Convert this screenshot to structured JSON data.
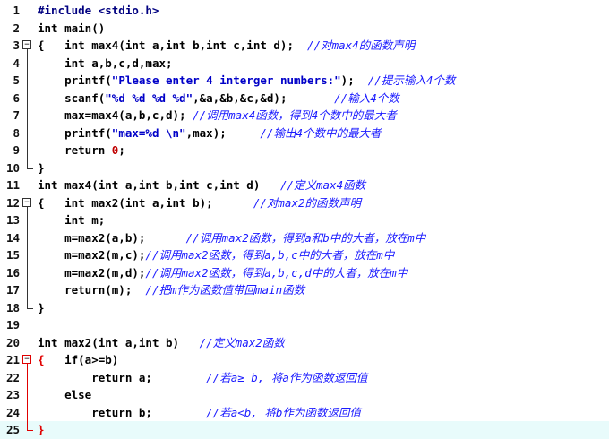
{
  "editor": {
    "current_line": 25,
    "lines": [
      {
        "n": "1",
        "fold": "",
        "segs": [
          [
            "pp",
            "#include <stdio.h>"
          ]
        ]
      },
      {
        "n": "2",
        "fold": "",
        "segs": [
          [
            "kw",
            "int "
          ],
          [
            "txt",
            "main()"
          ]
        ]
      },
      {
        "n": "3",
        "fold": "box",
        "segs": [
          [
            "txt",
            "{   "
          ],
          [
            "kw",
            "int "
          ],
          [
            "txt",
            "max4(int a,int b,int c,int d);  "
          ],
          [
            "cmt",
            "//对max4的函数声明"
          ]
        ]
      },
      {
        "n": "4",
        "fold": "",
        "segs": [
          [
            "txt",
            "    "
          ],
          [
            "kw",
            "int "
          ],
          [
            "txt",
            "a,b,c,d,max;"
          ]
        ]
      },
      {
        "n": "5",
        "fold": "",
        "segs": [
          [
            "txt",
            "    printf("
          ],
          [
            "str",
            "\"Please enter 4 interger numbers:\""
          ],
          [
            "txt",
            ");  "
          ],
          [
            "cmt",
            "//提示输入4个数"
          ]
        ]
      },
      {
        "n": "6",
        "fold": "",
        "segs": [
          [
            "txt",
            "    scanf("
          ],
          [
            "str",
            "\"%d %d %d %d\""
          ],
          [
            "txt",
            ",&a,&b,&c,&d);       "
          ],
          [
            "cmt",
            "//输入4个数"
          ]
        ]
      },
      {
        "n": "7",
        "fold": "",
        "segs": [
          [
            "txt",
            "    max=max4(a,b,c,d); "
          ],
          [
            "cmt",
            "//调用max4函数，得到4个数中的最大者"
          ]
        ]
      },
      {
        "n": "8",
        "fold": "",
        "segs": [
          [
            "txt",
            "    printf("
          ],
          [
            "str",
            "\"max=%d \\n\""
          ],
          [
            "txt",
            ",max);     "
          ],
          [
            "cmt",
            "//输出4个数中的最大者"
          ]
        ]
      },
      {
        "n": "9",
        "fold": "",
        "segs": [
          [
            "txt",
            "    return "
          ],
          [
            "num",
            "0"
          ],
          [
            "txt",
            ";"
          ]
        ]
      },
      {
        "n": "10",
        "fold": "end",
        "segs": [
          [
            "txt",
            "}"
          ]
        ]
      },
      {
        "n": "11",
        "fold": "",
        "segs": [
          [
            "kw",
            "int "
          ],
          [
            "txt",
            "max4(int a,int b,int c,int d)   "
          ],
          [
            "cmt",
            "//定义max4函数"
          ]
        ]
      },
      {
        "n": "12",
        "fold": "box",
        "segs": [
          [
            "txt",
            "{   "
          ],
          [
            "kw",
            "int "
          ],
          [
            "txt",
            "max2(int a,int b);      "
          ],
          [
            "cmt",
            "//对max2的函数声明"
          ]
        ]
      },
      {
        "n": "13",
        "fold": "",
        "segs": [
          [
            "txt",
            "    "
          ],
          [
            "kw",
            "int "
          ],
          [
            "txt",
            "m;"
          ]
        ]
      },
      {
        "n": "14",
        "fold": "",
        "segs": [
          [
            "txt",
            "    m=max2(a,b);      "
          ],
          [
            "cmt",
            "//调用max2函数，得到a和b中的大者，放在m中"
          ]
        ]
      },
      {
        "n": "15",
        "fold": "",
        "segs": [
          [
            "txt",
            "    m=max2(m,c);"
          ],
          [
            "cmt",
            "//调用max2函数，得到a,b,c中的大者，放在m中"
          ]
        ]
      },
      {
        "n": "16",
        "fold": "",
        "segs": [
          [
            "txt",
            "    m=max2(m,d);"
          ],
          [
            "cmt",
            "//调用max2函数，得到a,b,c,d中的大者，放在m中"
          ]
        ]
      },
      {
        "n": "17",
        "fold": "",
        "segs": [
          [
            "txt",
            "    return(m);  "
          ],
          [
            "cmt",
            "//把m作为函数值带回main函数"
          ]
        ]
      },
      {
        "n": "18",
        "fold": "end",
        "segs": [
          [
            "txt",
            "}"
          ]
        ]
      },
      {
        "n": "19",
        "fold": "",
        "segs": []
      },
      {
        "n": "20",
        "fold": "",
        "segs": [
          [
            "kw",
            "int "
          ],
          [
            "txt",
            "max2(int a,int b)   "
          ],
          [
            "cmt",
            "//定义max2函数"
          ]
        ]
      },
      {
        "n": "21",
        "fold": "boxred",
        "segs": [
          [
            "redbrace",
            "{"
          ],
          [
            "txt",
            "   if(a>=b)"
          ]
        ]
      },
      {
        "n": "22",
        "fold": "",
        "segs": [
          [
            "txt",
            "        return a;        "
          ],
          [
            "cmt",
            "//若a≥ b, 将a作为函数返回值"
          ]
        ]
      },
      {
        "n": "23",
        "fold": "",
        "segs": [
          [
            "txt",
            "    else"
          ]
        ]
      },
      {
        "n": "24",
        "fold": "",
        "segs": [
          [
            "txt",
            "        return b;        "
          ],
          [
            "cmt",
            "//若a<b, 将b作为函数返回值"
          ]
        ]
      },
      {
        "n": "25",
        "fold": "endred",
        "segs": [
          [
            "redbrace",
            "}"
          ]
        ]
      }
    ]
  }
}
